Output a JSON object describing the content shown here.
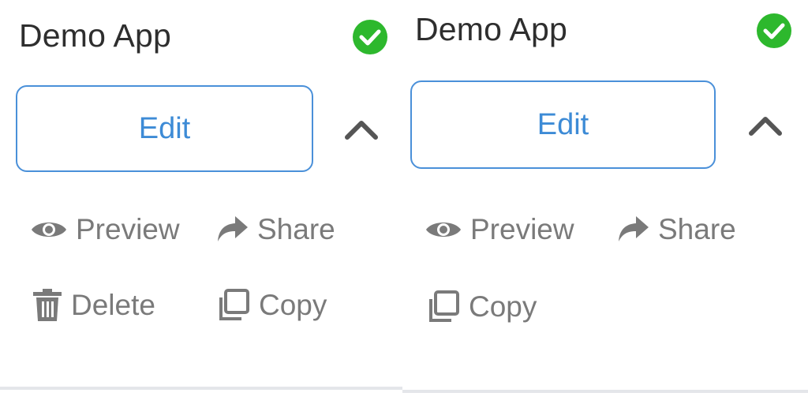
{
  "panels": [
    {
      "title": "Demo App",
      "status_icon": "check-circle-icon",
      "edit_label": "Edit",
      "toggle_icon": "chevron-up-icon",
      "actions": [
        {
          "label": "Preview",
          "icon": "eye-icon"
        },
        {
          "label": "Share",
          "icon": "share-arrow-icon"
        },
        {
          "label": "Delete",
          "icon": "trash-icon"
        },
        {
          "label": "Copy",
          "icon": "copy-icon"
        }
      ]
    },
    {
      "title": "Demo App",
      "status_icon": "check-circle-icon",
      "edit_label": "Edit",
      "toggle_icon": "chevron-up-icon",
      "actions": [
        {
          "label": "Preview",
          "icon": "eye-icon"
        },
        {
          "label": "Share",
          "icon": "share-arrow-icon"
        },
        {
          "label": "Copy",
          "icon": "copy-icon"
        }
      ]
    }
  ],
  "colors": {
    "status_green": "#2db82d",
    "edit_blue": "#3d8bd6",
    "action_gray": "#7a7a7a",
    "title_dark": "#2e2e2e"
  }
}
